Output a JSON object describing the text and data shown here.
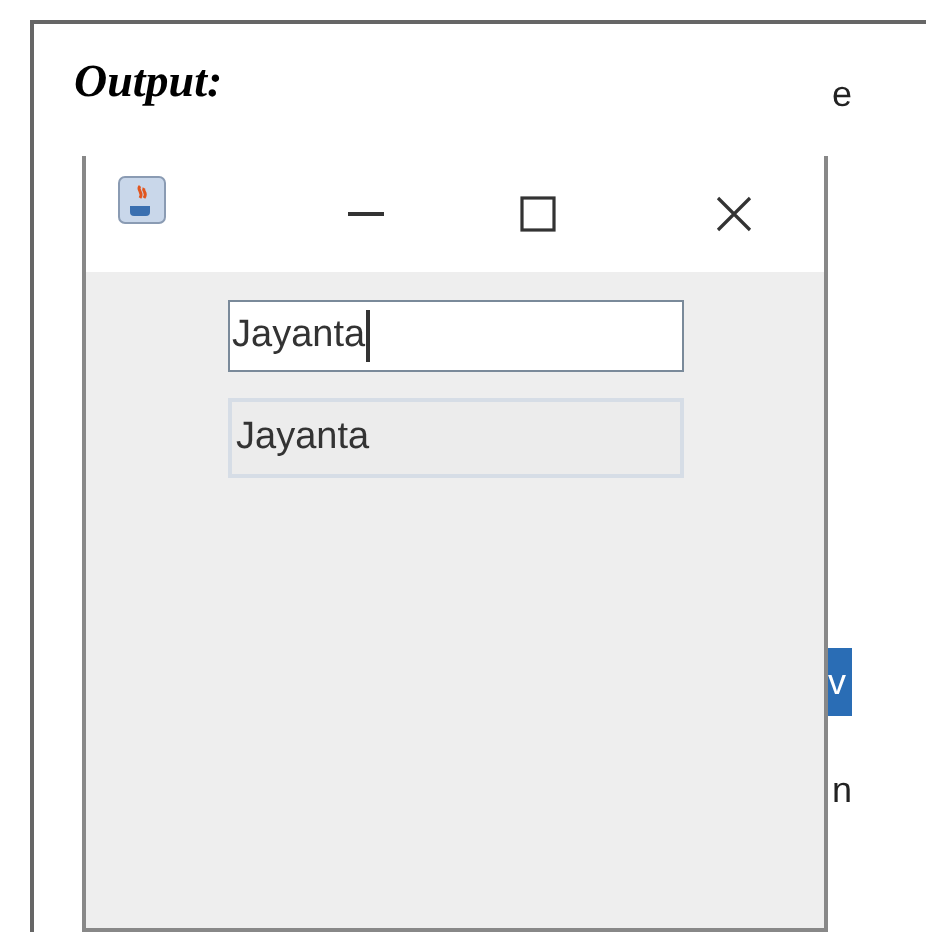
{
  "heading": "Output:",
  "window": {
    "controls": [
      {
        "kind": "minimize"
      },
      {
        "kind": "maximize"
      },
      {
        "kind": "close"
      }
    ],
    "text_field": {
      "value": "Jayanta",
      "focused": true
    },
    "label": "Jayanta"
  },
  "background_fragments": [
    {
      "text": "e",
      "kind": "plain"
    },
    {
      "text": "v",
      "kind": "highlight"
    },
    {
      "text": "n",
      "kind": "plain"
    }
  ]
}
